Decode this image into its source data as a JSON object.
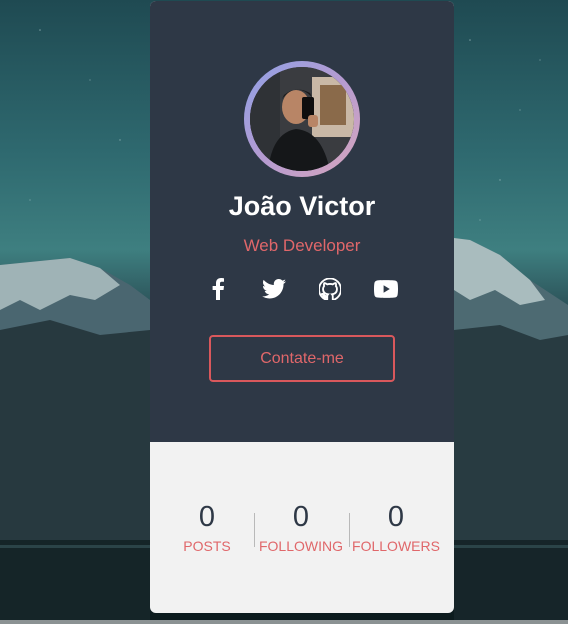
{
  "profile": {
    "name": "João Victor",
    "role": "Web Developer"
  },
  "socials": [
    {
      "icon": "facebook-icon"
    },
    {
      "icon": "twitter-icon"
    },
    {
      "icon": "github-icon"
    },
    {
      "icon": "youtube-icon"
    }
  ],
  "contact_button": {
    "label": "Contate-me"
  },
  "stats": [
    {
      "value": "0",
      "label": "POSTS"
    },
    {
      "value": "0",
      "label": "FOLLOWING"
    },
    {
      "value": "0",
      "label": "FOLLOWERS"
    }
  ],
  "colors": {
    "card_dark": "#2e3846",
    "accent": "#e0676a",
    "stats_bg": "#f2f2f2"
  }
}
